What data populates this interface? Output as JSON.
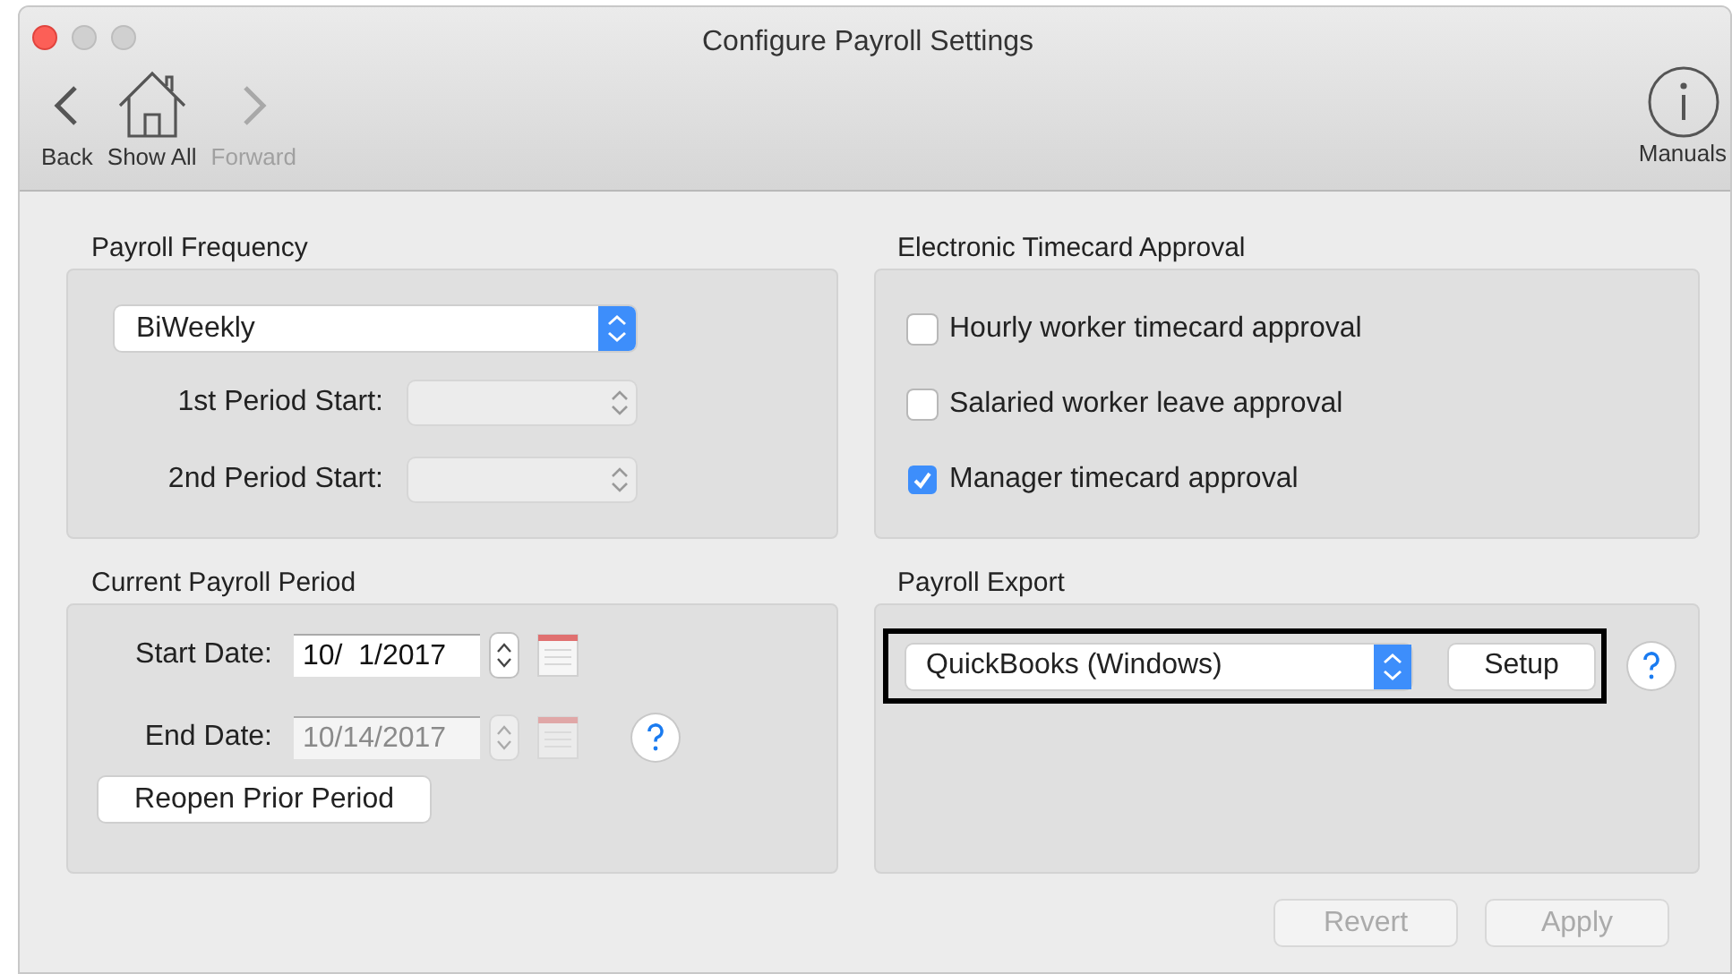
{
  "window": {
    "title": "Configure Payroll Settings"
  },
  "toolbar": {
    "items": [
      {
        "kind": "back",
        "label": "Back",
        "disabled": false
      },
      {
        "kind": "home",
        "label": "Show All",
        "disabled": false
      },
      {
        "kind": "forward",
        "label": "Forward",
        "disabled": true
      }
    ],
    "manuals": {
      "label": "Manuals"
    }
  },
  "payroll_frequency": {
    "title": "Payroll Frequency",
    "popup": {
      "value": "BiWeekly"
    },
    "fields": [
      {
        "label": "1st Period Start:",
        "disabled": true
      },
      {
        "label": "2nd Period Start:",
        "disabled": true
      }
    ]
  },
  "timecard_approval": {
    "title": "Electronic Timecard Approval",
    "options": [
      {
        "label": "Hourly worker timecard approval",
        "checked": false
      },
      {
        "label": "Salaried worker leave approval",
        "checked": false
      },
      {
        "label": "Manager timecard approval",
        "checked": true
      }
    ]
  },
  "current_period": {
    "title": "Current Payroll Period",
    "dates": [
      {
        "label": "Start Date:",
        "value": "10/  1/2017",
        "disabled": false,
        "help": false
      },
      {
        "label": "End Date:",
        "value": "10/14/2017",
        "disabled": true,
        "help": true
      }
    ],
    "button": "Reopen Prior Period"
  },
  "payroll_export": {
    "title": "Payroll Export",
    "popup": {
      "value": "QuickBooks (Windows)"
    },
    "focused": true,
    "button": "Setup"
  },
  "footer": {
    "buttons": [
      {
        "label": "Revert",
        "disabled": true
      },
      {
        "label": "Apply",
        "disabled": true
      }
    ]
  }
}
